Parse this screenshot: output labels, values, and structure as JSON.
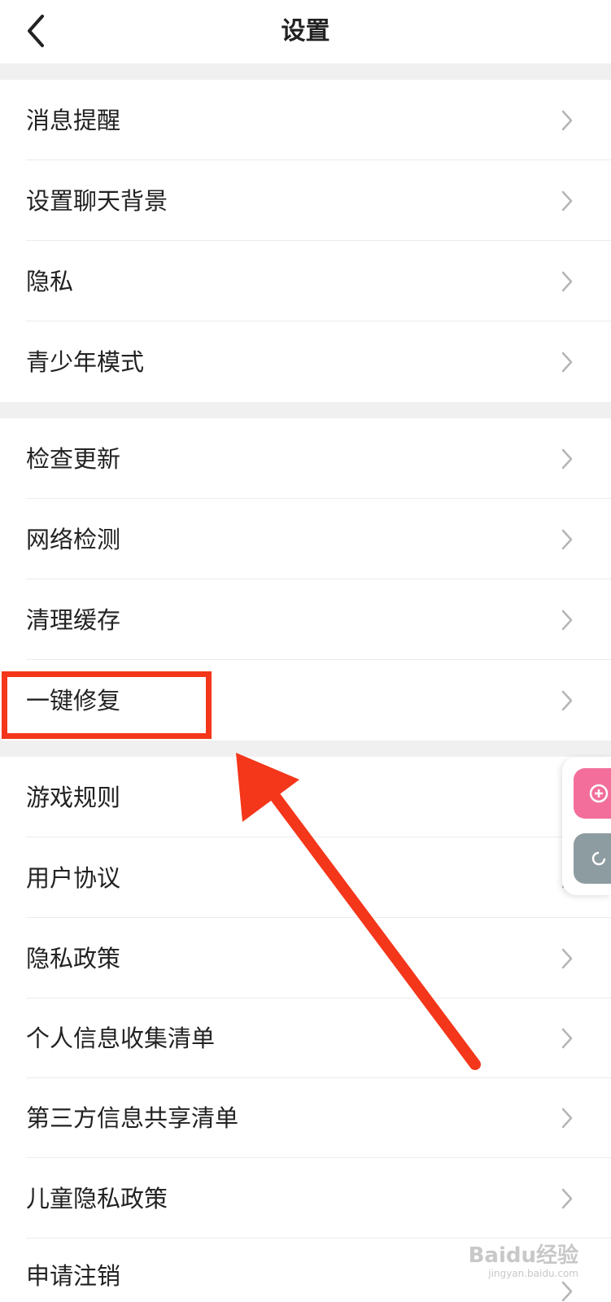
{
  "header": {
    "title": "设置",
    "back_icon": "chevron-left-icon"
  },
  "groups": [
    {
      "items": [
        {
          "label": "消息提醒"
        },
        {
          "label": "设置聊天背景"
        },
        {
          "label": "隐私"
        },
        {
          "label": "青少年模式"
        }
      ]
    },
    {
      "items": [
        {
          "label": "检查更新"
        },
        {
          "label": "网络检测"
        },
        {
          "label": "清理缓存"
        },
        {
          "label": "一键修复"
        }
      ]
    },
    {
      "items": [
        {
          "label": "游戏规则"
        },
        {
          "label": "用户协议"
        },
        {
          "label": "隐私政策"
        },
        {
          "label": "个人信息收集清单"
        },
        {
          "label": "第三方信息共享清单"
        },
        {
          "label": "儿童隐私政策"
        },
        {
          "label": "申请注销"
        }
      ]
    }
  ],
  "annotation": {
    "highlight_color": "#f4361a",
    "highlighted_item": "一键修复"
  },
  "floating_buttons": {
    "pink_color": "#f36e9b",
    "gray_color": "#8d9ca0"
  },
  "watermark": {
    "text": "Baidu经验",
    "sub": "jingyan.baidu.com"
  }
}
